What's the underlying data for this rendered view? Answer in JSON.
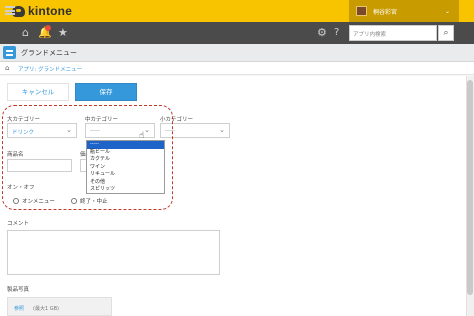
{
  "header": {
    "logo_text": "kintone",
    "user_name": "桐谷彩宮",
    "user_caret": "⌄",
    "search_placeholder": "アプリ内検索"
  },
  "app": {
    "title": "グランドメニュー",
    "breadcrumb": "アプリ: グランドメニュー"
  },
  "actions": {
    "cancel_label": "キャンセル",
    "save_label": "保存"
  },
  "form": {
    "category_large": {
      "label": "大カテゴリー",
      "value": "ドリンク"
    },
    "category_mid": {
      "label": "中カテゴリー",
      "value": "-----"
    },
    "category_small": {
      "label": "小カテゴリー",
      "value": "-----"
    },
    "mid_options": [
      "-----",
      "瓶ビール",
      "カクテル",
      "ワイン",
      "リキュール",
      "その他",
      "スピリッツ"
    ],
    "product_name": {
      "label": "商品名"
    },
    "price": {
      "label": "価格"
    },
    "onoff": {
      "label": "オン・オフ",
      "options": [
        "オンメニュー",
        "終了・中止"
      ]
    },
    "comment": {
      "label": "コメント"
    },
    "photo": {
      "label": "製品写真",
      "browse": "参照",
      "max_size": "(最大1 GB)"
    }
  },
  "colors": {
    "brand": "#f8c400",
    "accent": "#3498db",
    "highlight": "#c0392b"
  }
}
